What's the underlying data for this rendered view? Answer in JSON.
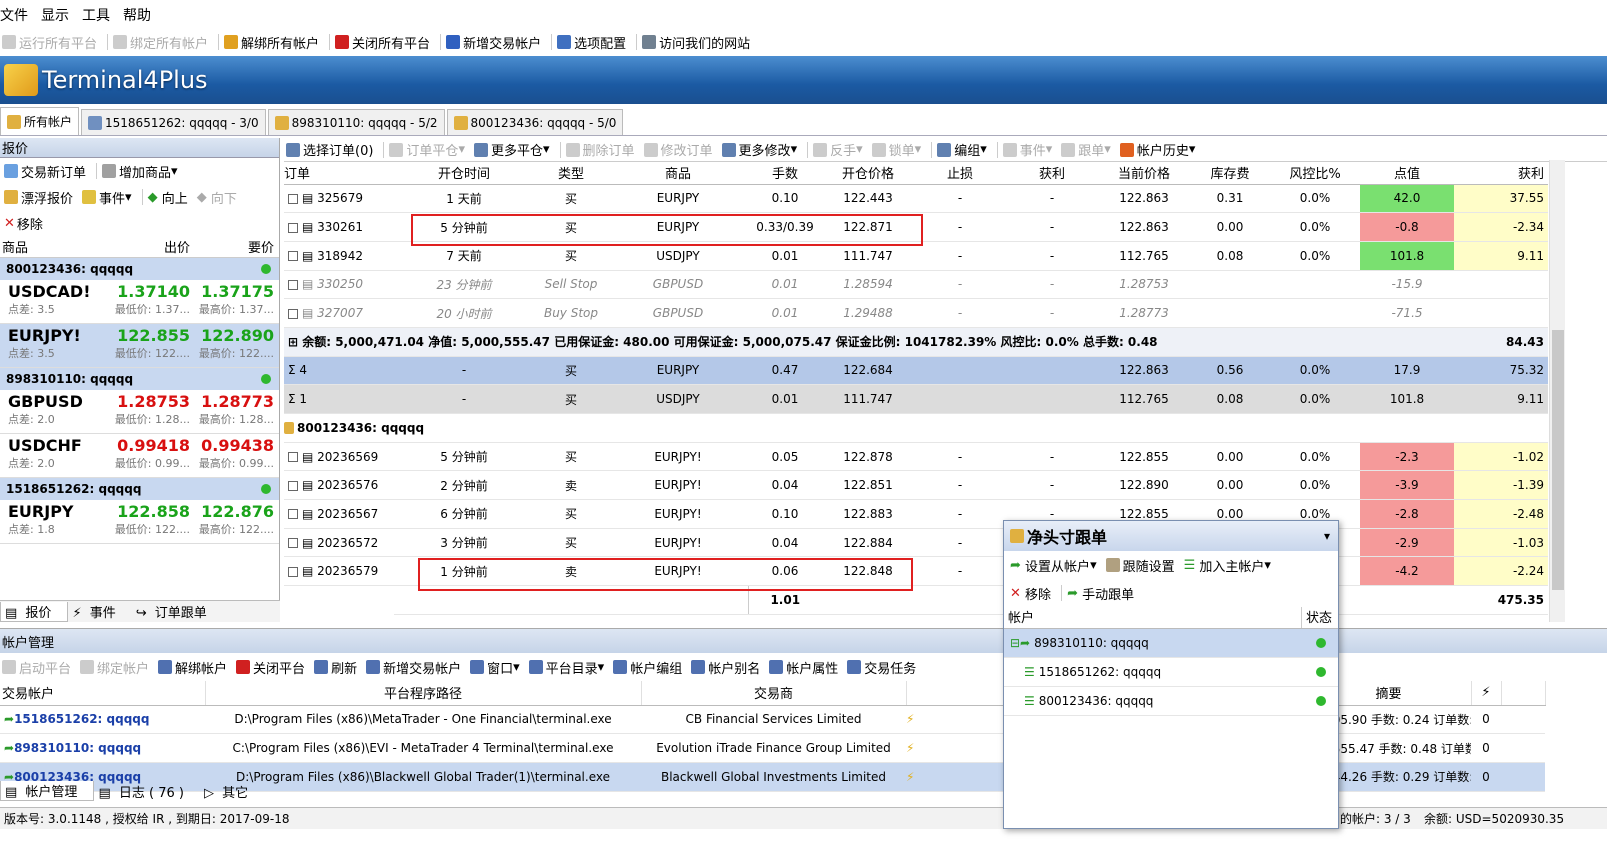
{
  "menu": [
    "文件",
    "显示",
    "工具",
    "帮助"
  ],
  "toolbar": [
    {
      "label": "运行所有平台",
      "disabled": true
    },
    {
      "label": "绑定所有帐户",
      "disabled": true
    },
    {
      "label": "解绑所有帐户",
      "disabled": false
    },
    {
      "label": "关闭所有平台",
      "disabled": false
    },
    {
      "label": "新增交易帐户",
      "disabled": false
    },
    {
      "label": "选项配置",
      "disabled": false
    },
    {
      "label": "访问我们的网站",
      "disabled": false
    }
  ],
  "app_title": "Terminal4Plus",
  "account_tabs": [
    "所有帐户",
    "1518651262: qqqqq - 3/0",
    "898310110: qqqqq - 5/2",
    "800123436: qqqqq - 5/0"
  ],
  "quotes": {
    "header": "报价",
    "tool1": [
      "交易新订单",
      "增加商品"
    ],
    "tool2": [
      "漂浮报价",
      "事件",
      "向上",
      "向下"
    ],
    "tool3": [
      "移除"
    ],
    "columns": [
      "商品",
      "出价",
      "要价"
    ],
    "groups": [
      {
        "name": "800123436: qqqqq",
        "rows": [
          {
            "sym": "USDCAD!",
            "spread": "点差: 3.5",
            "bid": "1.37140",
            "ask": "1.37175",
            "bid_low": "最低价: 1.37...",
            "ask_high": "最高价: 1.37...",
            "dir": "up",
            "sel": false
          },
          {
            "sym": "EURJPY!",
            "spread": "点差: 3.5",
            "bid": "122.855",
            "ask": "122.890",
            "bid_low": "最低价: 122....",
            "ask_high": "最高价: 122....",
            "dir": "up",
            "sel": true
          }
        ]
      },
      {
        "name": "898310110: qqqqq",
        "rows": [
          {
            "sym": "GBPUSD",
            "spread": "点差: 2.0",
            "bid": "1.28753",
            "ask": "1.28773",
            "bid_low": "最低价: 1.28...",
            "ask_high": "最高价: 1.28...",
            "dir": "dn",
            "sel": false
          },
          {
            "sym": "USDCHF",
            "spread": "点差: 2.0",
            "bid": "0.99418",
            "ask": "0.99438",
            "bid_low": "最低价: 0.99...",
            "ask_high": "最高价: 0.99...",
            "dir": "dn",
            "sel": false
          }
        ]
      },
      {
        "name": "1518651262: qqqqq",
        "rows": [
          {
            "sym": "EURJPY",
            "spread": "点差: 1.8",
            "bid": "122.858",
            "ask": "122.876",
            "bid_low": "最低价: 122....",
            "ask_high": "最高价: 122....",
            "dir": "up",
            "sel": false
          }
        ]
      }
    ],
    "bottom_tabs": [
      "报价",
      "事件",
      "订单跟单"
    ]
  },
  "orders": {
    "toolbar": [
      "选择订单(0)",
      "订单平仓",
      "更多平仓",
      "删除订单",
      "修改订单",
      "更多修改",
      "反手",
      "锁单",
      "编组",
      "事件",
      "跟单",
      "帐户历史"
    ],
    "columns": [
      "订单",
      "开仓时间",
      "类型",
      "商品",
      "手数",
      "开仓价格",
      "止损",
      "获利",
      "当前价格",
      "库存费",
      "风控比%",
      "点值",
      "获利"
    ],
    "rows": [
      {
        "kind": "order",
        "c": [
          "325679",
          "1 天前",
          "买",
          "EURJPY",
          "0.10",
          "122.443",
          "-",
          "-",
          "122.863",
          "0.31",
          "0.0%",
          "42.0",
          "37.55"
        ],
        "pc": "g"
      },
      {
        "kind": "order",
        "c": [
          "330261",
          "5 分钟前",
          "买",
          "EURJPY",
          "0.33/0.39",
          "122.871",
          "-",
          "-",
          "122.863",
          "0.00",
          "0.0%",
          "-0.8",
          "-2.34"
        ],
        "pc": "r"
      },
      {
        "kind": "order",
        "c": [
          "318942",
          "7 天前",
          "买",
          "USDJPY",
          "0.01",
          "111.747",
          "-",
          "-",
          "112.765",
          "0.08",
          "0.0%",
          "101.8",
          "9.11"
        ],
        "pc": "g"
      },
      {
        "kind": "pend",
        "c": [
          "330250",
          "23 分钟前",
          "Sell Stop",
          "GBPUSD",
          "0.01",
          "1.28594",
          "-",
          "-",
          "1.28753",
          "",
          "",
          "-15.9",
          ""
        ],
        "pc": ""
      },
      {
        "kind": "pend",
        "c": [
          "327007",
          "20 小时前",
          "Buy Stop",
          "GBPUSD",
          "0.01",
          "1.29488",
          "-",
          "-",
          "1.28773",
          "",
          "",
          "-71.5",
          ""
        ],
        "pc": ""
      },
      {
        "kind": "sum",
        "text": "余额: 5,000,471.04  净值: 5,000,555.47  已用保证金: 480.00  可用保证金: 5,000,075.47  保证金比例: 1041782.39%  风控比: 0.0%  总手数: 0.48",
        "profit": "84.43"
      },
      {
        "kind": "agg",
        "c": [
          "4",
          "-",
          "买",
          "EURJPY",
          "0.47",
          "122.684",
          "",
          "",
          "122.863",
          "0.56",
          "0.0%",
          "17.9",
          "75.32"
        ]
      },
      {
        "kind": "agg2",
        "c": [
          "1",
          "-",
          "买",
          "USDJPY",
          "0.01",
          "111.747",
          "",
          "",
          "112.765",
          "0.08",
          "0.0%",
          "101.8",
          "9.11"
        ]
      },
      {
        "kind": "acct",
        "text": "800123436: qqqqq"
      },
      {
        "kind": "order",
        "c": [
          "20236569",
          "5 分钟前",
          "买",
          "EURJPY!",
          "0.05",
          "122.878",
          "-",
          "-",
          "122.855",
          "0.00",
          "0.0%",
          "-2.3",
          "-1.02"
        ],
        "pc": "r"
      },
      {
        "kind": "order",
        "c": [
          "20236576",
          "2 分钟前",
          "卖",
          "EURJPY!",
          "0.04",
          "122.851",
          "-",
          "-",
          "122.890",
          "0.00",
          "0.0%",
          "-3.9",
          "-1.39"
        ],
        "pc": "r"
      },
      {
        "kind": "order",
        "c": [
          "20236567",
          "6 分钟前",
          "买",
          "EURJPY!",
          "0.10",
          "122.883",
          "-",
          "-",
          "122.855",
          "0.00",
          "0.0%",
          "-2.8",
          "-2.48"
        ],
        "pc": "r"
      },
      {
        "kind": "order",
        "c": [
          "20236572",
          "3 分钟前",
          "买",
          "EURJPY!",
          "0.04",
          "122.884",
          "-",
          "-",
          "122.855",
          "0.00",
          "0.0%",
          "-2.9",
          "-1.03"
        ],
        "pc": "r"
      },
      {
        "kind": "order",
        "c": [
          "20236579",
          "1 分钟前",
          "卖",
          "EURJPY!",
          "0.06",
          "122.848",
          "-",
          "-",
          "122.890",
          "0.00",
          "0.0%",
          "-4.2",
          "-2.24"
        ],
        "pc": "r"
      }
    ],
    "total_lots": "1.01",
    "total_profit": "475.35"
  },
  "account_mgmt": {
    "header": "帐户管理",
    "toolbar": [
      {
        "label": "启动平台",
        "disabled": true
      },
      {
        "label": "绑定帐户",
        "disabled": true
      },
      {
        "label": "解绑帐户",
        "disabled": false
      },
      {
        "label": "关闭平台",
        "disabled": false
      },
      {
        "label": "刷新",
        "disabled": false
      },
      {
        "label": "新增交易帐户",
        "disabled": false
      },
      {
        "label": "窗口",
        "disabled": false
      },
      {
        "label": "平台目录",
        "disabled": false
      },
      {
        "label": "帐户编组",
        "disabled": false
      },
      {
        "label": "帐户别名",
        "disabled": false
      },
      {
        "label": "帐户属性",
        "disabled": false
      },
      {
        "label": "交易任务",
        "disabled": false
      }
    ],
    "columns": [
      "交易帐户",
      "平台程序路径",
      "交易商",
      "摘要"
    ],
    "rows": [
      {
        "acct": "1518651262: qqqqq",
        "path": "D:\\Program Files (x86)\\MetaTrader - One Financial\\terminal.exe",
        "broker": "CB Financial Services Limited",
        "summary": "10,805.90  手数: 0.24  订单数: 3",
        "n": "0",
        "sel": false
      },
      {
        "acct": "898310110: qqqqq",
        "path": "C:\\Program Files (x86)\\EVI - MetaTrader 4 Terminal\\terminal.exe",
        "broker": "Evolution iTrade Finance Group Limited",
        "summary": "000,555.47  手数: 0.48  订单数: 5",
        "n": "0",
        "sel": false
      },
      {
        "acct": "800123436: qqqqq",
        "path": "D:\\Program Files (x86)\\Blackwell Global Trader(1)\\terminal.exe",
        "broker": "Blackwell Global Investments Limited",
        "summary": "10,044.26  手数: 0.29  订单数: 5",
        "n": "0",
        "sel": true
      }
    ],
    "bottom_tabs": [
      "帐户管理",
      "日志 ( 76 )",
      "其它"
    ]
  },
  "status": {
    "left": "版本号: 3.0.1148 , 授权给 IR , 到期日: 2017-09-18",
    "right1": "的帐户: 3 / 3",
    "right2": "余额: USD=5020930.35"
  },
  "popup": {
    "title": "净头寸跟单",
    "tool1": [
      "设置从帐户",
      "跟随设置",
      "加入主帐户"
    ],
    "tool2": [
      "移除",
      "手动跟单"
    ],
    "columns": [
      "帐户",
      "状态"
    ],
    "rows": [
      "898310110: qqqqq",
      "1518651262: qqqqq",
      "800123436: qqqqq"
    ]
  }
}
